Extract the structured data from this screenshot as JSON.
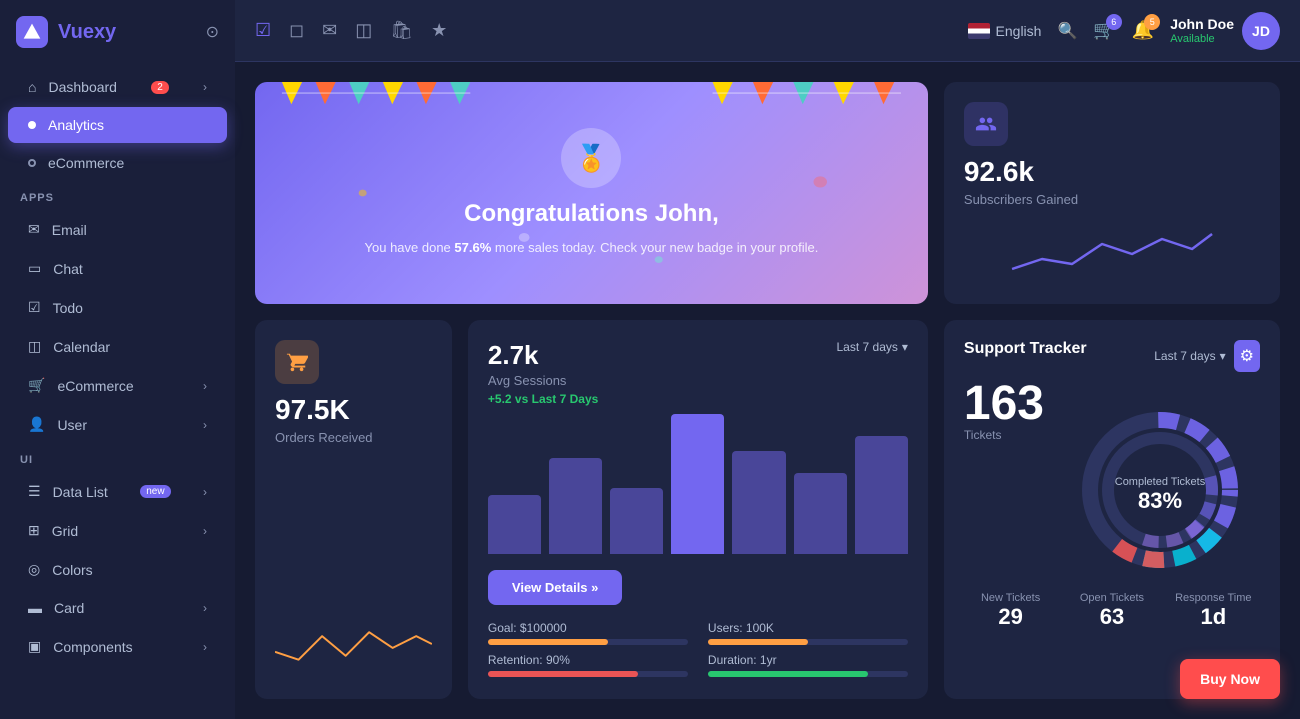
{
  "app": {
    "name": "Vuexy"
  },
  "sidebar": {
    "dashboard_label": "Dashboard",
    "dashboard_badge": "2",
    "analytics_label": "Analytics",
    "ecommerce_label": "eCommerce",
    "apps_section": "APPS",
    "email_label": "Email",
    "chat_label": "Chat",
    "todo_label": "Todo",
    "calendar_label": "Calendar",
    "ecommerce_app_label": "eCommerce",
    "user_label": "User",
    "ui_section": "UI",
    "datalist_label": "Data List",
    "datalist_badge": "new",
    "grid_label": "Grid",
    "colors_label": "Colors",
    "card_label": "Card",
    "components_label": "Components"
  },
  "topbar": {
    "lang": "English",
    "user_name": "John Doe",
    "user_status": "Available",
    "cart_badge": "6",
    "notif_badge": "5"
  },
  "congrats": {
    "title": "Congratulations John,",
    "desc_start": "You have done ",
    "highlight": "57.6%",
    "desc_end": " more sales today. Check your new badge in your profile."
  },
  "stat1": {
    "value": "92.6k",
    "label": "Subscribers Gained"
  },
  "stat2": {
    "value": "97.5K",
    "label": "Orders Received"
  },
  "sessions": {
    "value": "2.7k",
    "label": "Avg Sessions",
    "delta": "+5.2 vs Last 7 Days",
    "period": "Last 7 days",
    "view_details": "View Details »",
    "goal_label": "Goal: $100000",
    "users_label": "Users: 100K",
    "retention_label": "Retention: 90%",
    "duration_label": "Duration: 1yr",
    "goal_pct": 60,
    "users_pct": 50,
    "retention_pct": 75,
    "duration_pct": 80
  },
  "support": {
    "title": "Support Tracker",
    "tickets_value": "163",
    "tickets_label": "Tickets",
    "period": "Last 7 days",
    "completed_label": "Completed Tickets",
    "completed_pct": "83%",
    "new_tickets_label": "New Tickets",
    "new_tickets_value": "29",
    "open_tickets_label": "Open Tickets",
    "open_tickets_value": "63",
    "response_label": "Response Time",
    "response_value": "1d"
  },
  "buy_now": "Buy Now",
  "bars": [
    40,
    65,
    45,
    95,
    70,
    55,
    80
  ],
  "colors": {
    "purple": "#7367f0",
    "orange": "#ff9f43",
    "green": "#28c76f",
    "red": "#ea5455",
    "teal": "#00cfe8"
  }
}
